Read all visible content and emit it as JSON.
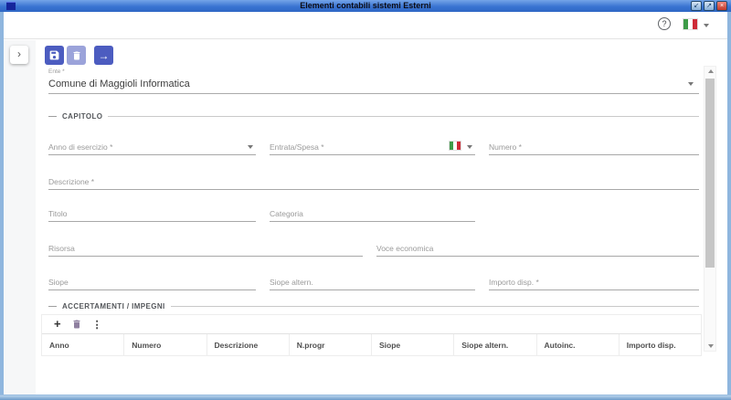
{
  "window": {
    "title": "Elementi contabili sistemi Esterni",
    "controls": {
      "minimize": "↙",
      "maximize": "↗",
      "close": "×"
    }
  },
  "header": {
    "help": "?",
    "language_flag": "italian-flag"
  },
  "sidebar": {
    "expand": "›"
  },
  "toolbar": {
    "save_icon": "floppy-disk",
    "delete_icon": "trash-can",
    "proceed_glyph": "→"
  },
  "ente": {
    "label": "Ente *",
    "value": "Comune di Maggioli Informatica"
  },
  "capitolo": {
    "title": "CAPITOLO",
    "fields": {
      "anno": "Anno di esercizio *",
      "entrata_spesa": "Entrata/Spesa *",
      "numero": "Numero *",
      "descrizione": "Descrizione *",
      "titolo": "Titolo",
      "categoria": "Categoria",
      "risorsa": "Risorsa",
      "voce_economica": "Voce economica",
      "siope": "Siope",
      "siope_altern": "Siope altern.",
      "importo_disp": "Importo disp. *"
    }
  },
  "accertamenti": {
    "title": "ACCERTAMENTI / IMPEGNI",
    "add": "+",
    "more": "⋮",
    "headers": [
      "Anno",
      "Numero",
      "Descrizione",
      "N.progr",
      "Siope",
      "Siope altern.",
      "Autoinc.",
      "Importo disp."
    ]
  },
  "colors": {
    "accent": "#4c5cc0",
    "accent_disabled": "#9ba3da",
    "titlebar_blue": "#3a74d2",
    "window_border": "#8fb6de",
    "flag_green": "#3d9b48",
    "flag_red": "#ce2b37",
    "trash_muted": "#8f80a0"
  }
}
